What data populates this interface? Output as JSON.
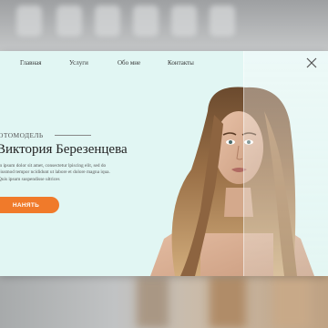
{
  "nav": {
    "items": [
      "Главная",
      "Услуги",
      "Обо мне",
      "Контакты"
    ]
  },
  "hero": {
    "eyebrow": "ОТОМОДЕЛЬ",
    "name": "Виктория Березенцева",
    "body": "m ipsum dolor sit amet, consectetur lpiscing elit, sed do eiusmod tempor ncididunt ut labore et dolore magna iqua. Quis ipsum suspendisse ultrices",
    "button_label": "НАНЯТЬ"
  },
  "colors": {
    "accent": "#f07a2a",
    "card_background": "#e1f6f3"
  },
  "icons": {
    "close": "close-icon"
  }
}
